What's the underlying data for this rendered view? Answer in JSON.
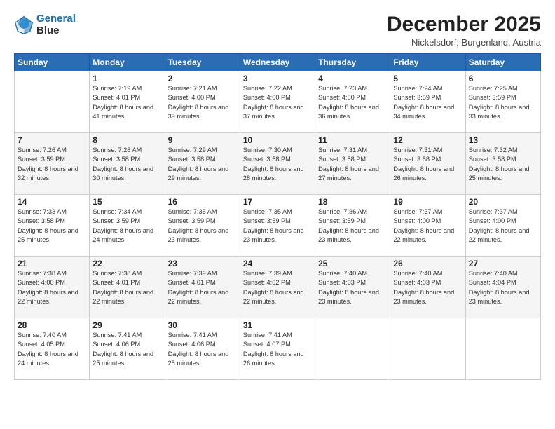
{
  "header": {
    "logo_line1": "General",
    "logo_line2": "Blue",
    "title": "December 2025",
    "subtitle": "Nickelsdorf, Burgenland, Austria"
  },
  "days_of_week": [
    "Sunday",
    "Monday",
    "Tuesday",
    "Wednesday",
    "Thursday",
    "Friday",
    "Saturday"
  ],
  "weeks": [
    [
      {
        "day": "",
        "sunrise": "",
        "sunset": "",
        "daylight": ""
      },
      {
        "day": "1",
        "sunrise": "Sunrise: 7:19 AM",
        "sunset": "Sunset: 4:01 PM",
        "daylight": "Daylight: 8 hours and 41 minutes."
      },
      {
        "day": "2",
        "sunrise": "Sunrise: 7:21 AM",
        "sunset": "Sunset: 4:00 PM",
        "daylight": "Daylight: 8 hours and 39 minutes."
      },
      {
        "day": "3",
        "sunrise": "Sunrise: 7:22 AM",
        "sunset": "Sunset: 4:00 PM",
        "daylight": "Daylight: 8 hours and 37 minutes."
      },
      {
        "day": "4",
        "sunrise": "Sunrise: 7:23 AM",
        "sunset": "Sunset: 4:00 PM",
        "daylight": "Daylight: 8 hours and 36 minutes."
      },
      {
        "day": "5",
        "sunrise": "Sunrise: 7:24 AM",
        "sunset": "Sunset: 3:59 PM",
        "daylight": "Daylight: 8 hours and 34 minutes."
      },
      {
        "day": "6",
        "sunrise": "Sunrise: 7:25 AM",
        "sunset": "Sunset: 3:59 PM",
        "daylight": "Daylight: 8 hours and 33 minutes."
      }
    ],
    [
      {
        "day": "7",
        "sunrise": "Sunrise: 7:26 AM",
        "sunset": "Sunset: 3:59 PM",
        "daylight": "Daylight: 8 hours and 32 minutes."
      },
      {
        "day": "8",
        "sunrise": "Sunrise: 7:28 AM",
        "sunset": "Sunset: 3:58 PM",
        "daylight": "Daylight: 8 hours and 30 minutes."
      },
      {
        "day": "9",
        "sunrise": "Sunrise: 7:29 AM",
        "sunset": "Sunset: 3:58 PM",
        "daylight": "Daylight: 8 hours and 29 minutes."
      },
      {
        "day": "10",
        "sunrise": "Sunrise: 7:30 AM",
        "sunset": "Sunset: 3:58 PM",
        "daylight": "Daylight: 8 hours and 28 minutes."
      },
      {
        "day": "11",
        "sunrise": "Sunrise: 7:31 AM",
        "sunset": "Sunset: 3:58 PM",
        "daylight": "Daylight: 8 hours and 27 minutes."
      },
      {
        "day": "12",
        "sunrise": "Sunrise: 7:31 AM",
        "sunset": "Sunset: 3:58 PM",
        "daylight": "Daylight: 8 hours and 26 minutes."
      },
      {
        "day": "13",
        "sunrise": "Sunrise: 7:32 AM",
        "sunset": "Sunset: 3:58 PM",
        "daylight": "Daylight: 8 hours and 25 minutes."
      }
    ],
    [
      {
        "day": "14",
        "sunrise": "Sunrise: 7:33 AM",
        "sunset": "Sunset: 3:58 PM",
        "daylight": "Daylight: 8 hours and 25 minutes."
      },
      {
        "day": "15",
        "sunrise": "Sunrise: 7:34 AM",
        "sunset": "Sunset: 3:59 PM",
        "daylight": "Daylight: 8 hours and 24 minutes."
      },
      {
        "day": "16",
        "sunrise": "Sunrise: 7:35 AM",
        "sunset": "Sunset: 3:59 PM",
        "daylight": "Daylight: 8 hours and 23 minutes."
      },
      {
        "day": "17",
        "sunrise": "Sunrise: 7:35 AM",
        "sunset": "Sunset: 3:59 PM",
        "daylight": "Daylight: 8 hours and 23 minutes."
      },
      {
        "day": "18",
        "sunrise": "Sunrise: 7:36 AM",
        "sunset": "Sunset: 3:59 PM",
        "daylight": "Daylight: 8 hours and 23 minutes."
      },
      {
        "day": "19",
        "sunrise": "Sunrise: 7:37 AM",
        "sunset": "Sunset: 4:00 PM",
        "daylight": "Daylight: 8 hours and 22 minutes."
      },
      {
        "day": "20",
        "sunrise": "Sunrise: 7:37 AM",
        "sunset": "Sunset: 4:00 PM",
        "daylight": "Daylight: 8 hours and 22 minutes."
      }
    ],
    [
      {
        "day": "21",
        "sunrise": "Sunrise: 7:38 AM",
        "sunset": "Sunset: 4:00 PM",
        "daylight": "Daylight: 8 hours and 22 minutes."
      },
      {
        "day": "22",
        "sunrise": "Sunrise: 7:38 AM",
        "sunset": "Sunset: 4:01 PM",
        "daylight": "Daylight: 8 hours and 22 minutes."
      },
      {
        "day": "23",
        "sunrise": "Sunrise: 7:39 AM",
        "sunset": "Sunset: 4:01 PM",
        "daylight": "Daylight: 8 hours and 22 minutes."
      },
      {
        "day": "24",
        "sunrise": "Sunrise: 7:39 AM",
        "sunset": "Sunset: 4:02 PM",
        "daylight": "Daylight: 8 hours and 22 minutes."
      },
      {
        "day": "25",
        "sunrise": "Sunrise: 7:40 AM",
        "sunset": "Sunset: 4:03 PM",
        "daylight": "Daylight: 8 hours and 23 minutes."
      },
      {
        "day": "26",
        "sunrise": "Sunrise: 7:40 AM",
        "sunset": "Sunset: 4:03 PM",
        "daylight": "Daylight: 8 hours and 23 minutes."
      },
      {
        "day": "27",
        "sunrise": "Sunrise: 7:40 AM",
        "sunset": "Sunset: 4:04 PM",
        "daylight": "Daylight: 8 hours and 23 minutes."
      }
    ],
    [
      {
        "day": "28",
        "sunrise": "Sunrise: 7:40 AM",
        "sunset": "Sunset: 4:05 PM",
        "daylight": "Daylight: 8 hours and 24 minutes."
      },
      {
        "day": "29",
        "sunrise": "Sunrise: 7:41 AM",
        "sunset": "Sunset: 4:06 PM",
        "daylight": "Daylight: 8 hours and 25 minutes."
      },
      {
        "day": "30",
        "sunrise": "Sunrise: 7:41 AM",
        "sunset": "Sunset: 4:06 PM",
        "daylight": "Daylight: 8 hours and 25 minutes."
      },
      {
        "day": "31",
        "sunrise": "Sunrise: 7:41 AM",
        "sunset": "Sunset: 4:07 PM",
        "daylight": "Daylight: 8 hours and 26 minutes."
      },
      {
        "day": "",
        "sunrise": "",
        "sunset": "",
        "daylight": ""
      },
      {
        "day": "",
        "sunrise": "",
        "sunset": "",
        "daylight": ""
      },
      {
        "day": "",
        "sunrise": "",
        "sunset": "",
        "daylight": ""
      }
    ]
  ]
}
